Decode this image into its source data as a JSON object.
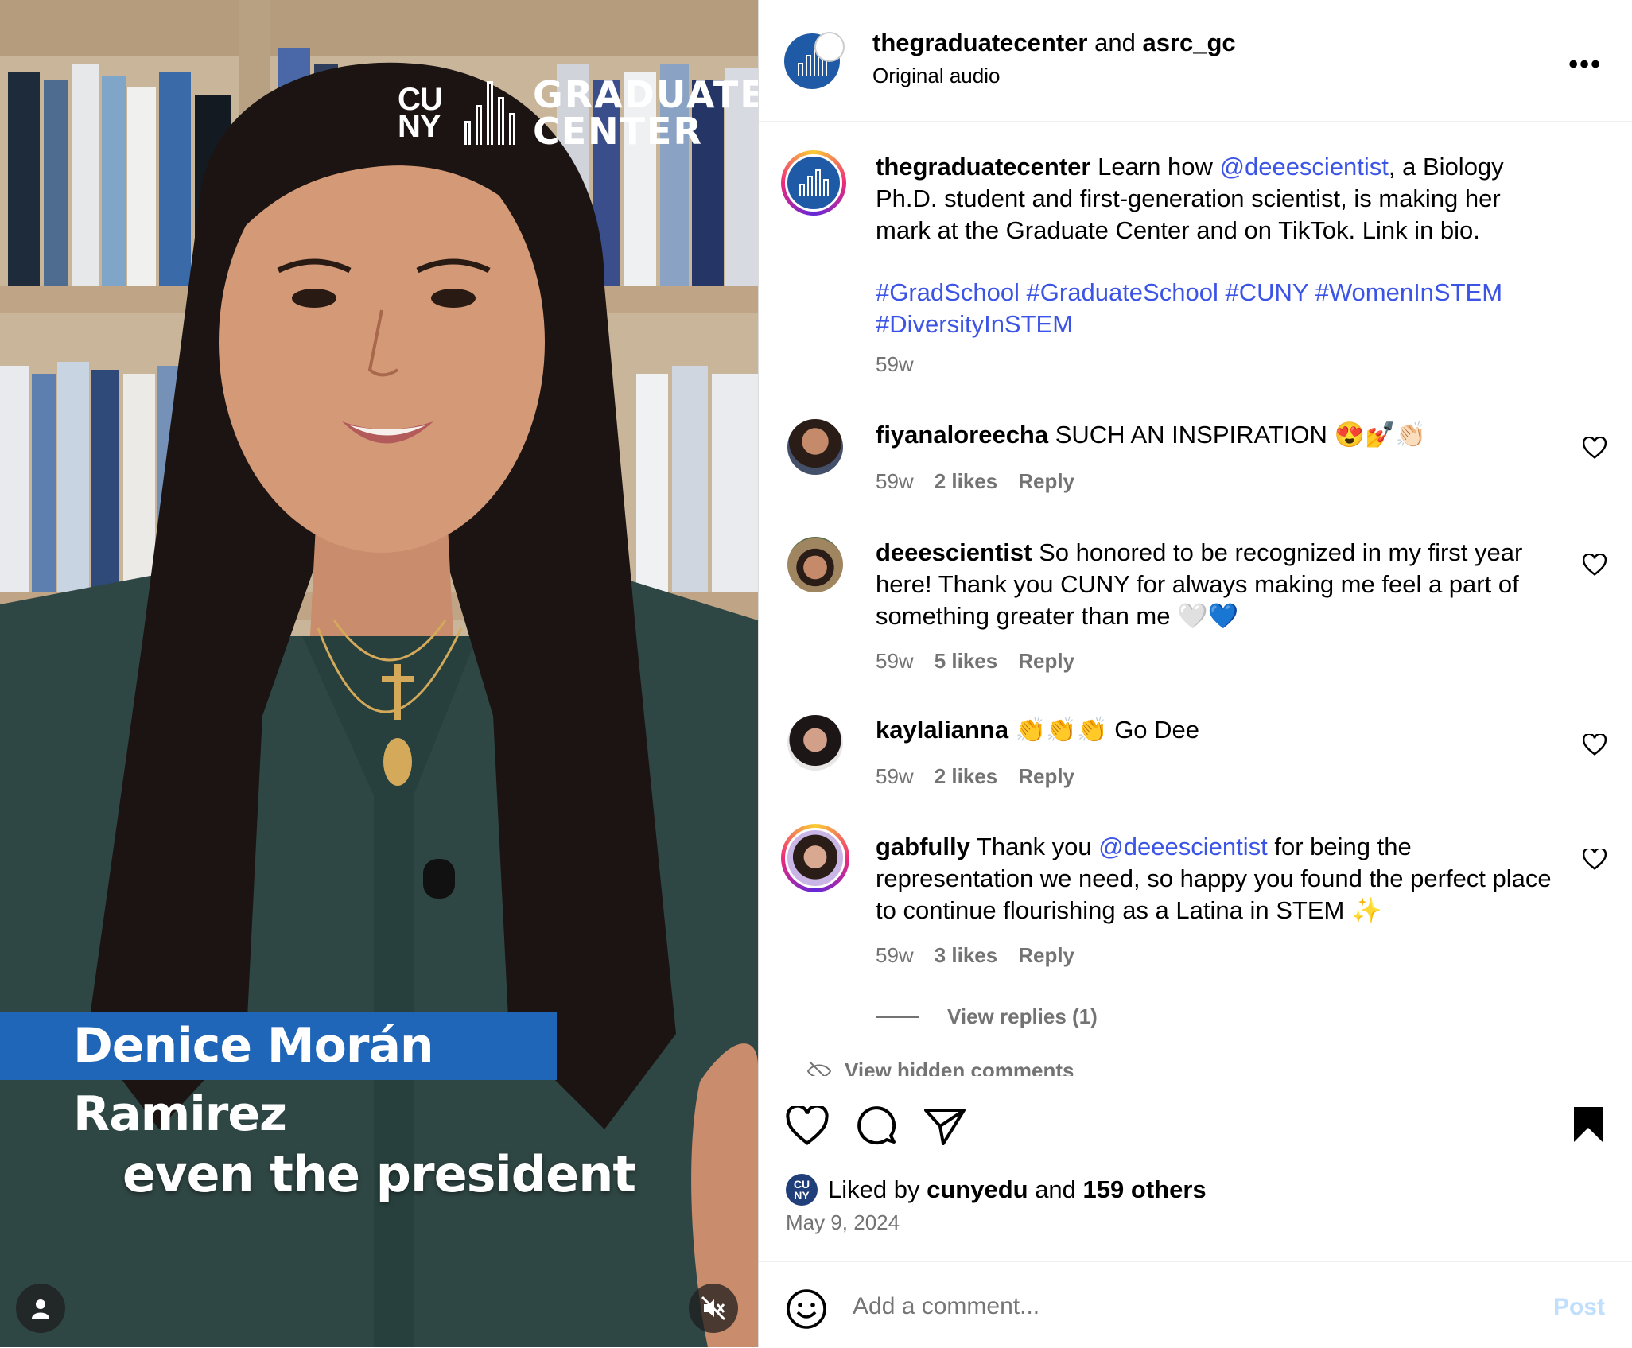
{
  "video": {
    "logo_cuny": "CU NY",
    "logo_text": "GRADUATE CENTER",
    "name_banner": "Denice Morán Ramirez",
    "caption": "even the president"
  },
  "header": {
    "account1": "thegraduatecenter",
    "joiner": "and",
    "account2": "asrc_gc",
    "audio": "Original audio",
    "more": "•••"
  },
  "post": {
    "username": "thegraduatecenter",
    "text_1": "Learn how",
    "mention": "@deeescientist",
    "text_2": ", a Biology Ph.D. student and first-generation scientist, is making her mark at the Graduate Center and on TikTok. Link in bio.",
    "hashtags_1": "#GradSchool #GraduateSchool #CUNY #WomenInSTEM",
    "hashtags_2": "#DiversityInSTEM",
    "time": "59w"
  },
  "comments": [
    {
      "user": "fiyanaloreecha",
      "text": "SUCH AN INSPIRATION 😍💅👏🏻",
      "time": "59w",
      "likes": "2 likes",
      "reply": "Reply"
    },
    {
      "user": "deeescientist",
      "text": "So honored to be recognized in my first year here! Thank you CUNY for always making me feel a part of something greater than me 🤍💙",
      "time": "59w",
      "likes": "5 likes",
      "reply": "Reply"
    },
    {
      "user": "kaylalianna",
      "text": "👏👏👏 Go Dee",
      "time": "59w",
      "likes": "2 likes",
      "reply": "Reply"
    },
    {
      "user": "gabfully",
      "text_1": "Thank you",
      "mention": "@deeescientist",
      "text_2": "for being the representation we need, so happy you found the perfect place to continue flourishing as a Latina in STEM ✨",
      "time": "59w",
      "likes": "3 likes",
      "reply": "Reply"
    }
  ],
  "view_replies": "View replies (1)",
  "hidden_comments": "View hidden comments",
  "liked": {
    "prefix": "Liked by",
    "user": "cunyedu",
    "joiner": "and",
    "others": "159 others",
    "avatar_text": "CU NY",
    "date": "May 9, 2024"
  },
  "add_comment": {
    "placeholder": "Add a comment...",
    "post_label": "Post"
  },
  "colors": {
    "link": "#3c54e6",
    "brand_blue": "#1f5aa6",
    "banner_blue": "#1f66b8",
    "post_disabled": "#c0dffd"
  }
}
